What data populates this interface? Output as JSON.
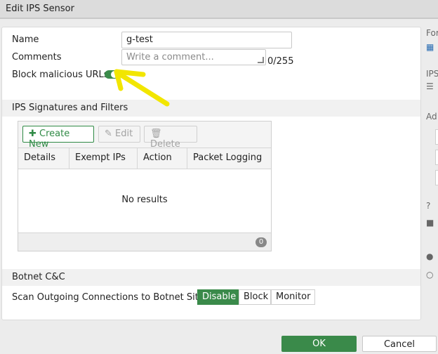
{
  "window": {
    "title": "Edit IPS Sensor"
  },
  "form": {
    "name_label": "Name",
    "name_value": "g-test",
    "comments_label": "Comments",
    "comments_placeholder": "Write a comment...",
    "comments_counter": "0/255",
    "block_malicious_label": "Block malicious URLs",
    "block_malicious_enabled": true
  },
  "signatures": {
    "section_title": "IPS Signatures and Filters",
    "toolbar": {
      "create_new": "Create New",
      "edit": "Edit",
      "delete": "Delete"
    },
    "columns": [
      "Details",
      "Exempt IPs",
      "Action",
      "Packet Logging"
    ],
    "empty_text": "No results",
    "count": "0"
  },
  "botnet": {
    "section_title": "Botnet C&C",
    "scan_label": "Scan Outgoing Connections to Botnet Sites",
    "options": [
      "Disable",
      "Block",
      "Monitor"
    ],
    "selected": "Disable"
  },
  "footer": {
    "ok": "OK",
    "cancel": "Cancel"
  },
  "right_panel": {
    "label_1": "For",
    "label_2": "IPS",
    "label_3": "Ad"
  },
  "colors": {
    "accent": "#3a8a4a",
    "annotation": "#f2e600"
  }
}
